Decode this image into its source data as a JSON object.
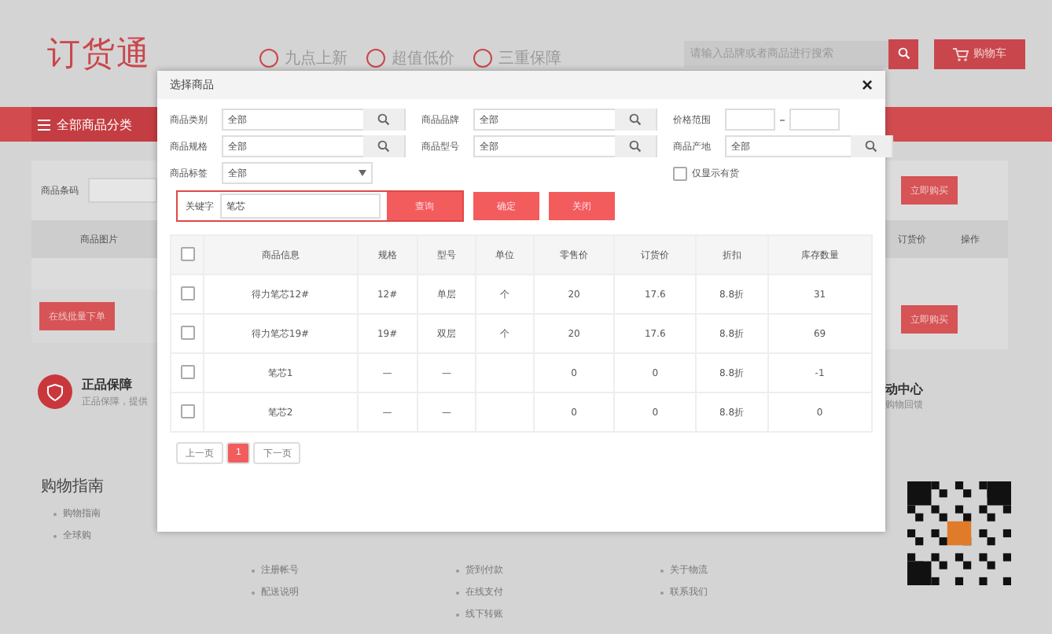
{
  "header": {
    "logo": "订货通",
    "features": [
      "九点上新",
      "超值低价",
      "三重保障"
    ],
    "search": {
      "placeholder": "请输入品牌或者商品进行搜索"
    },
    "cart": "购物车"
  },
  "nav": {
    "category_menu": "全部商品分类"
  },
  "left_panel": {
    "barcode_label": "商品条码",
    "image_column": "商品图片",
    "batch_button": "在线批量下单"
  },
  "right_panel": {
    "buy_buttons": [
      "立即购买",
      "立即购买"
    ],
    "columns": [
      "订货价",
      "操作"
    ]
  },
  "guarantee": {
    "title": "正品保障",
    "subtitle": "正品保障，提供"
  },
  "activity": {
    "title": "动中心",
    "subtitle": "购物回馈"
  },
  "footer": {
    "heading": "购物指南",
    "columns": [
      [
        "购物指南",
        "全球购"
      ],
      [
        "注册帐号",
        "配送说明"
      ],
      [
        "货到付款",
        "在线支付",
        "线下转账"
      ],
      [
        "关于物流",
        "联系我们"
      ]
    ]
  },
  "dialog": {
    "title": "选择商品",
    "close": "×",
    "filters": [
      {
        "label": "商品类别",
        "value": "全部",
        "kind": "lookup"
      },
      {
        "label": "商品品牌",
        "value": "全部",
        "kind": "lookup"
      },
      {
        "label": "价格范围",
        "kind": "range"
      },
      {
        "label": "商品规格",
        "value": "全部",
        "kind": "lookup"
      },
      {
        "label": "商品型号",
        "value": "全部",
        "kind": "lookup"
      },
      {
        "label": "商品产地",
        "value": "全部",
        "kind": "lookup"
      },
      {
        "label": "商品标签",
        "value": "全部",
        "kind": "select"
      },
      {
        "label": "仅显示有货",
        "kind": "checkbox",
        "checked": false
      }
    ],
    "keyword": {
      "label": "关键字",
      "value": "笔芯"
    },
    "buttons": [
      "查询",
      "确定",
      "关闭"
    ],
    "table": {
      "select_all": {
        "checked": false
      },
      "columns": [
        "商品信息",
        "规格",
        "型号",
        "单位",
        "零售价",
        "订货价",
        "折扣",
        "库存数量"
      ],
      "rows": [
        {
          "checked": false,
          "cells": [
            "得力笔芯12#",
            "12#",
            "单层",
            "个",
            "20",
            "17.6",
            "8.8折",
            "31"
          ]
        },
        {
          "checked": false,
          "cells": [
            "得力笔芯19#",
            "19#",
            "双层",
            "个",
            "20",
            "17.6",
            "8.8折",
            "69"
          ]
        },
        {
          "checked": false,
          "cells": [
            "笔芯1",
            "—",
            "—",
            null,
            "0",
            "0",
            "8.8折",
            "-1"
          ]
        },
        {
          "checked": false,
          "cells": [
            "笔芯2",
            "—",
            "—",
            null,
            "0",
            "0",
            "8.8折",
            "0"
          ]
        }
      ]
    },
    "pagination": {
      "prev": "上一页",
      "pages": [
        {
          "label": "1",
          "selected": true
        }
      ],
      "next": "下一页"
    }
  }
}
